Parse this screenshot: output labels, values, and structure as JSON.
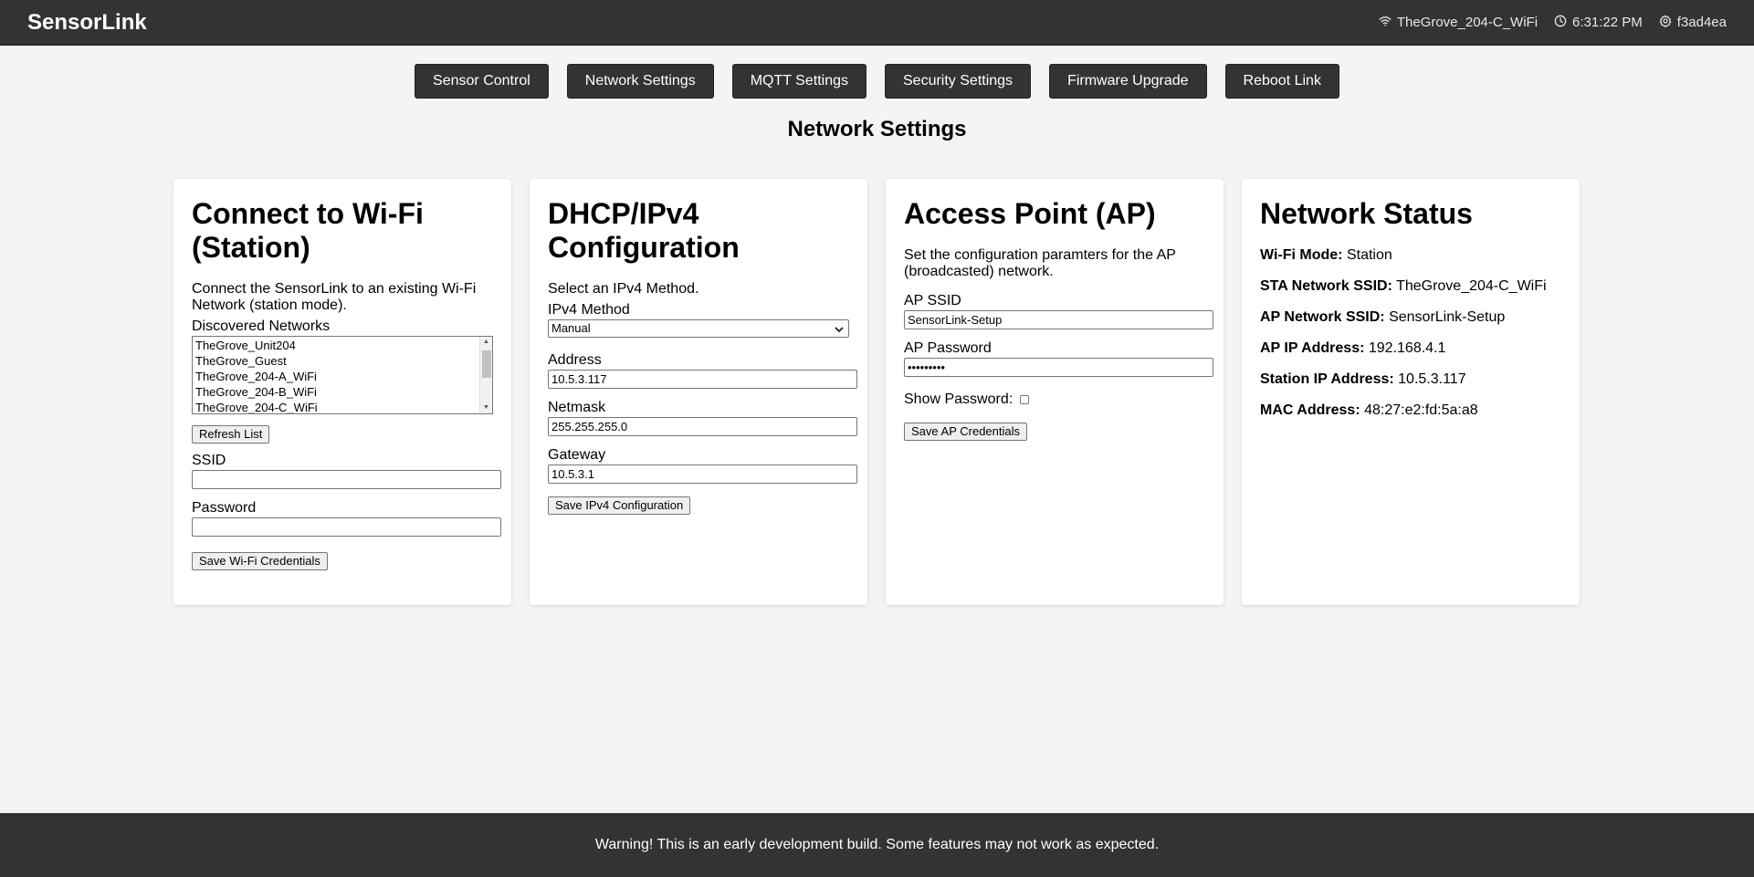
{
  "header": {
    "brand": "SensorLink",
    "wifi_ssid": "TheGrove_204-C_WiFi",
    "time": "6:31:22 PM",
    "device_id": "f3ad4ea"
  },
  "nav": [
    {
      "label": "Sensor Control"
    },
    {
      "label": "Network Settings"
    },
    {
      "label": "MQTT Settings"
    },
    {
      "label": "Security Settings"
    },
    {
      "label": "Firmware Upgrade"
    },
    {
      "label": "Reboot Link"
    }
  ],
  "page_title": "Network Settings",
  "wifi": {
    "title": "Connect to Wi-Fi (Station)",
    "description": "Connect the SensorLink to an existing Wi-Fi Network (station mode).",
    "networks_label": "Discovered Networks",
    "networks": [
      "TheGrove_Unit204",
      "TheGrove_Guest",
      "TheGrove_204-A_WiFi",
      "TheGrove_204-B_WiFi",
      "TheGrove_204-C_WiFi"
    ],
    "refresh_label": "Refresh List",
    "ssid_label": "SSID",
    "ssid_value": "",
    "password_label": "Password",
    "password_value": "",
    "save_label": "Save Wi-Fi Credentials"
  },
  "dhcp": {
    "title": "DHCP/IPv4 Configuration",
    "description": "Select an IPv4 Method.",
    "method_label": "IPv4 Method",
    "method_value": "Manual",
    "address_label": "Address",
    "address_value": "10.5.3.117",
    "netmask_label": "Netmask",
    "netmask_value": "255.255.255.0",
    "gateway_label": "Gateway",
    "gateway_value": "10.5.3.1",
    "save_label": "Save IPv4 Configuration"
  },
  "ap": {
    "title": "Access Point (AP)",
    "description": "Set the configuration paramters for the AP (broadcasted) network.",
    "ssid_label": "AP SSID",
    "ssid_value": "SensorLink-Setup",
    "password_label": "AP Password",
    "password_value": "•••••••••",
    "show_password_label": "Show Password:",
    "save_label": "Save AP Credentials"
  },
  "status": {
    "title": "Network Status",
    "rows": [
      {
        "key": "Wi-Fi Mode:",
        "value": "Station"
      },
      {
        "key": "STA Network SSID:",
        "value": "TheGrove_204-C_WiFi"
      },
      {
        "key": "AP Network SSID:",
        "value": "SensorLink-Setup"
      },
      {
        "key": "AP IP Address:",
        "value": "192.168.4.1"
      },
      {
        "key": "Station IP Address:",
        "value": "10.5.3.117"
      },
      {
        "key": "MAC Address:",
        "value": "48:27:e2:fd:5a:a8"
      }
    ]
  },
  "footer": {
    "text": "Warning! This is an early development build. Some features may not work as expected."
  }
}
